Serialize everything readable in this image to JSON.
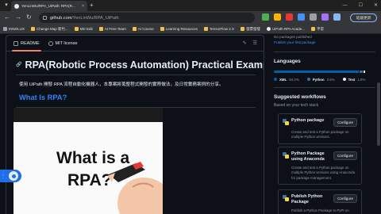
{
  "browser": {
    "tab_title": "YenLinWu/RPA_UiPath: RPA(R...",
    "tab_close": "×",
    "new_tab": "+",
    "menu_glyph": "▾",
    "window_controls": [
      "—",
      "☐",
      "✕"
    ],
    "nav": {
      "back": "←",
      "forward": "→",
      "reload": "↻"
    },
    "url_host": "github.com",
    "url_path": "/YenLinWu/RPA_UiPath",
    "profile_label": "延緩更新",
    "extension_colors": [
      "#4caf50",
      "#ffb300",
      "#e53935",
      "#4493f8",
      "#9aa0a6",
      "#a371f7",
      "#8ab4f8"
    ]
  },
  "bookmarks": [
    {
      "label": "INNOLUX",
      "icon": "folder-icon"
    },
    {
      "label": "Change Map 新竹...",
      "icon": "map-icon"
    },
    {
      "label": "MD Edit",
      "icon": "folder-icon"
    },
    {
      "label": "AI Free Team",
      "icon": "folder-icon"
    },
    {
      "label": "AI Course",
      "icon": "folder-icon"
    },
    {
      "label": "Learning Resources",
      "icon": "folder-icon"
    },
    {
      "label": "TensorFlow 2.X",
      "icon": "folder-icon"
    },
    {
      "label": "發票發發",
      "icon": "folder-icon"
    },
    {
      "label": "UiPath RPA Acade...",
      "icon": "github-icon"
    },
    {
      "label": "平常",
      "icon": "folder-icon"
    }
  ],
  "readme": {
    "tabs": [
      {
        "label": "README",
        "icon": "book-icon"
      },
      {
        "label": "MIT license",
        "icon": "scale-icon"
      }
    ],
    "edit_glyph": "✎",
    "toc_glyph": "☰",
    "title": "RPA(Robotic Process Automation) Practical Examples",
    "anchor_glyph": "🔗",
    "intro": "使用 UiPath 開發 RPA 流程自動化機器人，本專案將蒐整程式開發的實際做法，及日常實務案例的分享。",
    "section_heading": "What Is RPA?",
    "video": {
      "line1": "What is a",
      "line2": "RPA?"
    }
  },
  "sidebar": {
    "packages_text": "No packages published",
    "packages_link": "Publish your first package",
    "languages_heading": "Languages",
    "languages": [
      {
        "name": "XML",
        "pct": "94.2%",
        "value": 94.2,
        "color": "#0060ac"
      },
      {
        "name": "Python",
        "pct": "3.6%",
        "value": 3.6,
        "color": "#3572a5"
      },
      {
        "name": "Text",
        "pct": "1.8%",
        "value": 1.8,
        "color": "#ededed"
      }
    ],
    "workflows_heading": "Suggested workflows",
    "workflows_sub": "Based on your tech stack",
    "workflows": [
      {
        "title": "Python package",
        "desc": "Create and test a Python package on multiple Python versions.",
        "button": "Configure"
      },
      {
        "title": "Python Package using Anaconda",
        "desc": "Create and test a Python package on multiple Python versions using Anaconda for package management.",
        "button": "Configure"
      },
      {
        "title": "Publish Python Package",
        "desc": "Publish a Python Package to PyPI on",
        "button": "Configure"
      }
    ]
  }
}
